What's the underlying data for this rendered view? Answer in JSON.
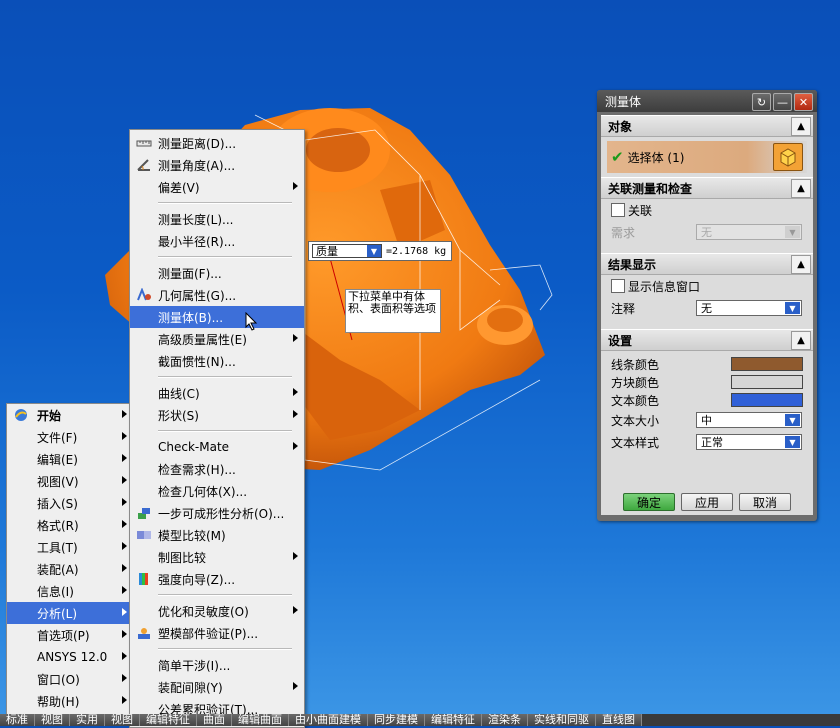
{
  "measurement": {
    "type_select": "质量",
    "value": "=2.1768 kg",
    "tooltip": "下拉菜单中有体积、表面积等选项"
  },
  "start_menu": {
    "items": [
      {
        "label": "开始",
        "bold": true
      },
      {
        "label": "文件(F)"
      },
      {
        "label": "编辑(E)"
      },
      {
        "label": "视图(V)"
      },
      {
        "label": "插入(S)"
      },
      {
        "label": "格式(R)"
      },
      {
        "label": "工具(T)"
      },
      {
        "label": "装配(A)"
      },
      {
        "label": "信息(I)"
      },
      {
        "label": "分析(L)",
        "highlighted": true
      },
      {
        "label": "首选项(P)"
      },
      {
        "label": "ANSYS 12.0"
      },
      {
        "label": "窗口(O)"
      },
      {
        "label": "帮助(H)"
      }
    ]
  },
  "analysis_menu": {
    "items": [
      "测量距离(D)...",
      "测量角度(A)...",
      "偏差(V)",
      "测量长度(L)...",
      "最小半径(R)...",
      "测量面(F)...",
      "几何属性(G)...",
      "测量体(B)...",
      "高级质量属性(E)",
      "截面惯性(N)...",
      "曲线(C)",
      "形状(S)",
      "Check-Mate",
      "检查需求(H)...",
      "检查几何体(X)...",
      "一步可成形性分析(O)...",
      "模型比较(M)",
      "制图比较",
      "强度向导(Z)...",
      "优化和灵敏度(O)",
      "塑模部件验证(P)...",
      "简单干涉(I)...",
      "装配间隙(Y)",
      "公差累积验证(T)..."
    ]
  },
  "dialog": {
    "title": "测量体",
    "object_section": "对象",
    "select_body": "选择体 (1)",
    "assoc_section": "关联测量和检查",
    "associative": "关联",
    "requirement_label": "需求",
    "requirement_value": "无",
    "results_section": "结果显示",
    "show_info_window": "显示信息窗口",
    "annotation_label": "注释",
    "annotation_value": "无",
    "settings_section": "设置",
    "line_color_label": "线条颜色",
    "block_color_label": "方块颜色",
    "text_color_label": "文本颜色",
    "text_size_label": "文本大小",
    "text_size_value": "中",
    "text_style_label": "文本样式",
    "text_style_value": "正常",
    "ok": "确定",
    "apply": "应用",
    "cancel": "取消",
    "colors": {
      "line": "#8f5a2e",
      "block": "#d6d6d6",
      "text": "#3060d8"
    }
  },
  "taskbar": {
    "items": [
      "标准",
      "视图",
      "实用",
      "视图",
      "编辑特征",
      "曲面",
      "编辑曲面",
      "由小曲面建模",
      "同步建模",
      "编辑特征",
      "渲染条",
      "实线和同驱",
      "直线图"
    ]
  }
}
